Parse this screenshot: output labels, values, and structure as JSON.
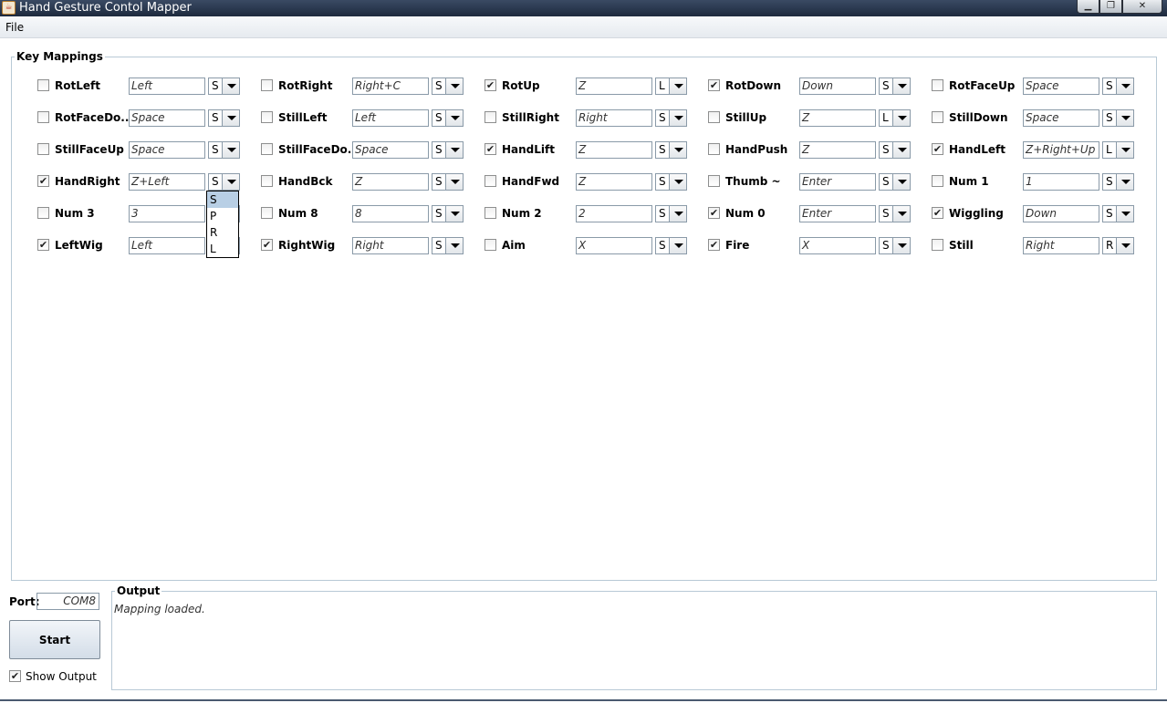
{
  "window": {
    "title": "Hand Gesture Contol Mapper",
    "icon": "java-app-icon"
  },
  "menu": {
    "file": "File"
  },
  "key_mappings": {
    "title": "Key Mappings",
    "rows": [
      [
        {
          "label": "RotLeft",
          "checked": false,
          "key": "Left",
          "mode": "S"
        },
        {
          "label": "RotRight",
          "checked": false,
          "key": "Right+C",
          "mode": "S"
        },
        {
          "label": "RotUp",
          "checked": true,
          "key": "Z",
          "mode": "L"
        },
        {
          "label": "RotDown",
          "checked": true,
          "key": "Down",
          "mode": "S"
        },
        {
          "label": "RotFaceUp",
          "checked": false,
          "key": "Space",
          "mode": "S"
        }
      ],
      [
        {
          "label": "RotFaceDo...",
          "checked": false,
          "key": "Space",
          "mode": "S"
        },
        {
          "label": "StillLeft",
          "checked": false,
          "key": "Left",
          "mode": "S"
        },
        {
          "label": "StillRight",
          "checked": false,
          "key": "Right",
          "mode": "S"
        },
        {
          "label": "StillUp",
          "checked": false,
          "key": "Z",
          "mode": "L"
        },
        {
          "label": "StillDown",
          "checked": false,
          "key": "Space",
          "mode": "S"
        }
      ],
      [
        {
          "label": "StillFaceUp",
          "checked": false,
          "key": "Space",
          "mode": "S"
        },
        {
          "label": "StillFaceDo...",
          "checked": false,
          "key": "Space",
          "mode": "S"
        },
        {
          "label": "HandLift",
          "checked": true,
          "key": "Z",
          "mode": "S"
        },
        {
          "label": "HandPush",
          "checked": false,
          "key": "Z",
          "mode": "S"
        },
        {
          "label": "HandLeft",
          "checked": true,
          "key": "Z+Right+Up",
          "mode": "L"
        }
      ],
      [
        {
          "label": "HandRight",
          "checked": true,
          "key": "Z+Left",
          "mode": "S"
        },
        {
          "label": "HandBck",
          "checked": false,
          "key": "Z",
          "mode": "S"
        },
        {
          "label": "HandFwd",
          "checked": false,
          "key": "Z",
          "mode": "S"
        },
        {
          "label": "Thumb ~",
          "checked": false,
          "key": "Enter",
          "mode": "S"
        },
        {
          "label": "Num 1",
          "checked": false,
          "key": "1",
          "mode": "S"
        }
      ],
      [
        {
          "label": "Num 3",
          "checked": false,
          "key": "3",
          "mode": ""
        },
        {
          "label": "Num 8",
          "checked": false,
          "key": "8",
          "mode": "S"
        },
        {
          "label": "Num 2",
          "checked": false,
          "key": "2",
          "mode": "S"
        },
        {
          "label": "Num 0",
          "checked": true,
          "key": "Enter",
          "mode": "S"
        },
        {
          "label": "Wiggling",
          "checked": true,
          "key": "Down",
          "mode": "S"
        }
      ],
      [
        {
          "label": "LeftWig",
          "checked": true,
          "key": "Left",
          "mode": ""
        },
        {
          "label": "RightWig",
          "checked": true,
          "key": "Right",
          "mode": "S"
        },
        {
          "label": "Aim",
          "checked": false,
          "key": "X",
          "mode": "S"
        },
        {
          "label": "Fire",
          "checked": true,
          "key": "X",
          "mode": "S"
        },
        {
          "label": "Still",
          "checked": false,
          "key": "Right",
          "mode": "R"
        }
      ]
    ],
    "dropdown_options": [
      "S",
      "P",
      "R",
      "L"
    ],
    "dropdown_selected": "S"
  },
  "port": {
    "label": "Port:",
    "value": "COM8"
  },
  "start_button": "Start",
  "show_output": {
    "label": "Show Output",
    "checked": true
  },
  "output": {
    "title": "Output",
    "text": "Mapping loaded."
  }
}
